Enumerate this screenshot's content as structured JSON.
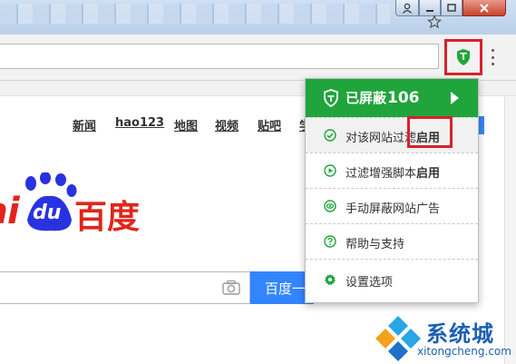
{
  "browser": {
    "extension_badge": "T"
  },
  "baidu": {
    "nav": [
      "新闻",
      "hao123",
      "地图",
      "视频",
      "贴吧",
      "学"
    ],
    "logo_latin": "ai",
    "logo_du": "du",
    "logo_cn": "百度",
    "search_button": "百度一下"
  },
  "dropdown": {
    "header_label": "已屏蔽",
    "header_count": "106",
    "items": [
      {
        "text": "对该网站过滤",
        "status": "启用"
      },
      {
        "text": "过滤增强脚本",
        "status": "启用"
      },
      {
        "text": "手动屏蔽网站广告",
        "status": ""
      },
      {
        "text": "帮助与支持",
        "status": ""
      },
      {
        "text": "设置选项",
        "status": ""
      }
    ]
  },
  "watermark": {
    "cn": "系统城",
    "en": "xitongcheng.com"
  },
  "colors": {
    "accent_green": "#1fa53b",
    "highlight_red": "#d9212a",
    "baidu_blue": "#3385ff",
    "baidu_red": "#e1251b",
    "watermark_blue": "#1a5fb4"
  }
}
